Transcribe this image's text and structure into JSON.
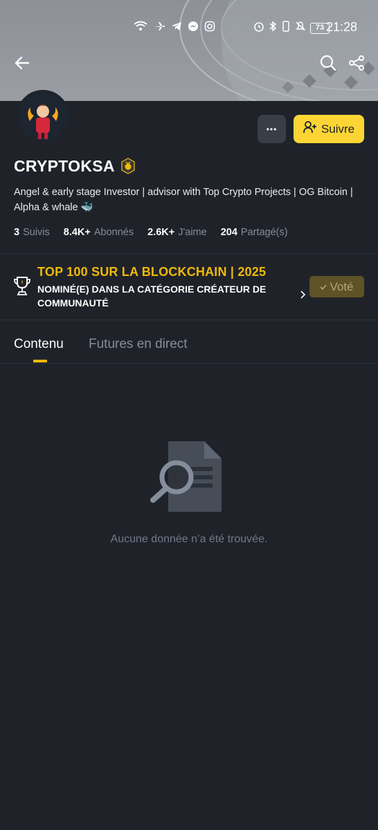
{
  "status_bar": {
    "time": "21:28",
    "battery": "73",
    "icons": [
      "wifi-icon",
      "airplane-icon",
      "telegram-icon",
      "messenger-icon",
      "instagram-icon",
      "alarm-icon",
      "bluetooth-icon",
      "vibrate-icon",
      "mute-icon"
    ]
  },
  "header": {
    "back_icon": "arrow-left-icon",
    "search_icon": "search-icon",
    "share_icon": "share-icon"
  },
  "profile": {
    "name": "CRYPTOKSA",
    "bio": "Angel & early stage Investor | advisor with Top Crypto Projects | OG Bitcoin | Alpha & whale 🐳",
    "more_label": "•••",
    "follow_label": "Suivre",
    "stats": [
      {
        "value": "3",
        "label": "Suivis"
      },
      {
        "value": "8.4K+",
        "label": "Abonnés"
      },
      {
        "value": "2.6K+",
        "label": "J'aime"
      },
      {
        "value": "204",
        "label": "Partagé(s)"
      }
    ]
  },
  "award": {
    "title": "TOP 100 SUR LA BLOCKCHAIN | 2025",
    "subtitle": "NOMINÉ(E) DANS LA CATÉGORIE CRÉATEUR DE COMMUNAUTÉ",
    "vote_label": "Voté"
  },
  "tabs": [
    {
      "label": "Contenu",
      "active": true
    },
    {
      "label": "Futures en direct",
      "active": false
    }
  ],
  "empty_state": {
    "message": "Aucune donnée n’a été trouvée."
  },
  "colors": {
    "background": "#1f2329",
    "accent": "#fcd535",
    "award_gold": "#f0b90b",
    "muted_text": "#848e9c"
  }
}
